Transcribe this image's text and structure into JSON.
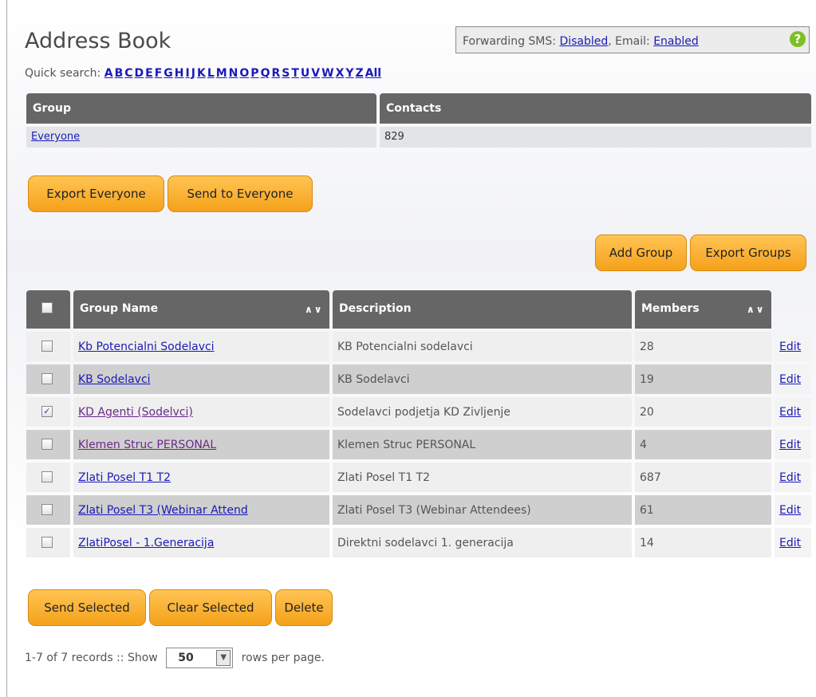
{
  "title": "Address Book",
  "forwarding": {
    "sms_label": "Forwarding SMS:",
    "sms_value": "Disabled",
    "email_label": ", Email:",
    "email_value": "Enabled"
  },
  "quick_search": {
    "label": "Quick search:",
    "letters": [
      "A",
      "B",
      "C",
      "D",
      "E",
      "F",
      "G",
      "H",
      "I",
      "J",
      "K",
      "L",
      "M",
      "N",
      "O",
      "P",
      "Q",
      "R",
      "S",
      "T",
      "U",
      "V",
      "W",
      "X",
      "Y",
      "Z",
      "All"
    ]
  },
  "groups_summary": {
    "headers": [
      "Group",
      "Contacts"
    ],
    "row": {
      "group": "Everyone",
      "contacts": "829"
    }
  },
  "buttons": {
    "export_everyone": "Export Everyone",
    "send_everyone": "Send to Everyone",
    "add_group": "Add Group",
    "export_groups": "Export Groups",
    "send_selected": "Send Selected",
    "clear_selected": "Clear Selected",
    "delete": "Delete"
  },
  "table": {
    "headers": {
      "name": "Group Name",
      "description": "Description",
      "members": "Members",
      "sort_glyph": "∧∨"
    },
    "rows": [
      {
        "name": "Kb Potencialni Sodelavci",
        "description": "KB Potencialni sodelavci",
        "members": "28",
        "edit": "Edit",
        "checked": false,
        "visited": false
      },
      {
        "name": "KB Sodelavci",
        "description": "KB Sodelavci",
        "members": "19",
        "edit": "Edit",
        "checked": false,
        "visited": false
      },
      {
        "name": "KD Agenti (Sodelvci)",
        "description": "Sodelavci podjetja KD Zivljenje",
        "members": "20",
        "edit": "Edit",
        "checked": true,
        "visited": true
      },
      {
        "name": "Klemen Struc PERSONAL",
        "description": "Klemen Struc PERSONAL",
        "members": "4",
        "edit": "Edit",
        "checked": false,
        "visited": true
      },
      {
        "name": "Zlati Posel T1 T2",
        "description": "Zlati Posel T1 T2",
        "members": "687",
        "edit": "Edit",
        "checked": false,
        "visited": false
      },
      {
        "name": "Zlati Posel T3 (Webinar Attend",
        "description": "Zlati Posel T3 (Webinar Attendees)",
        "members": "61",
        "edit": "Edit",
        "checked": false,
        "visited": false
      },
      {
        "name": "ZlatiPosel - 1.Generacija",
        "description": "Direktni sodelavci 1. generacija",
        "members": "14",
        "edit": "Edit",
        "checked": false,
        "visited": false
      }
    ]
  },
  "footer": {
    "records": "1-7 of 7 records :: Show",
    "rows_per_page": "50",
    "suffix": "rows per page."
  }
}
